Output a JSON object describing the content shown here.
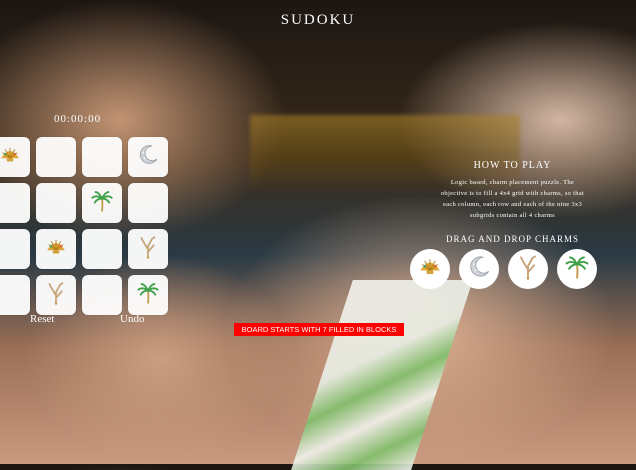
{
  "title": "SUDOKU",
  "timer": "00:00:00",
  "grid": [
    [
      "shell",
      "",
      "",
      "moon"
    ],
    [
      "",
      "",
      "palm",
      ""
    ],
    [
      "",
      "shell",
      "",
      "coral"
    ],
    [
      "",
      "coral",
      "",
      "palm"
    ]
  ],
  "controls": {
    "reset": "Reset",
    "undo": "Undo"
  },
  "banner": "BOARD STARTS WITH 7 FILLED IN BLOCKS",
  "how_to_play": {
    "heading": "HOW TO PLAY",
    "text": "Logic based, charm placement puzzle. The objective is to fill a 4x4 grid with charms, so that each column, each row and each of the nine 3x3 subgrids contain all 4 charms"
  },
  "drag_title": "DRAG AND DROP CHARMS",
  "charms": [
    "shell",
    "moon",
    "coral",
    "palm"
  ],
  "colors": {
    "banner": "#ff0000",
    "cell": "#ffffff"
  }
}
